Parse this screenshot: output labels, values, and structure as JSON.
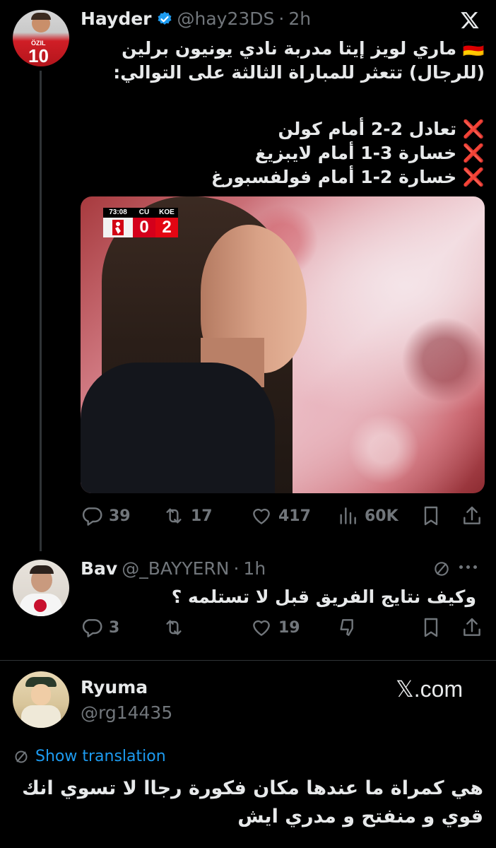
{
  "tweet": {
    "author_name": "Hayder",
    "handle": "@hay23DS",
    "dot": "·",
    "time": "2h",
    "line1": "🇩🇪 ماري لويز إيتا مدربة نادي يونيون برلين",
    "line2": "(للرجال) تتعثر للمباراة الثالثة على التوالي:",
    "results": [
      {
        "mark": "❌",
        "text": "تعادل 2-2 أمام كولن"
      },
      {
        "mark": "❌",
        "text": "خسارة 3-1 أمام لايبزيغ"
      },
      {
        "mark": "❌",
        "text": "خسارة 2-1 أمام فولفسبورغ"
      }
    ],
    "scoreboard": {
      "clock": "73:08",
      "home": "CU",
      "away": "KOE",
      "home_score": "0",
      "away_score": "2"
    },
    "replies": "39",
    "reposts": "17",
    "likes": "417",
    "views": "60K",
    "avatar_jersey": "ÖZIL",
    "avatar_number": "10"
  },
  "reply": {
    "author_name": "Bav",
    "handle": "@_BAYYERN",
    "dot": "·",
    "time": "1h",
    "text": "وكيف نتايج الفريق قبل لا تستلمه ؟",
    "replies": "3",
    "reposts": "",
    "likes": "19"
  },
  "quote": {
    "author_name": "Ryuma",
    "handle": "@rg14435",
    "site": "𝕏.com",
    "show_translation": "Show translation",
    "line1": "هي كمراة ما عندها مكان فكورة رجاا لا تسوي انك",
    "line2": "قوي و منفتح و مدري ايش"
  },
  "colors": {
    "background": "#000000",
    "text": "#e7e9ea",
    "muted": "#71767b",
    "verified": "#1d9bf0",
    "link": "#1d9bf0",
    "divider": "#2f3336"
  }
}
